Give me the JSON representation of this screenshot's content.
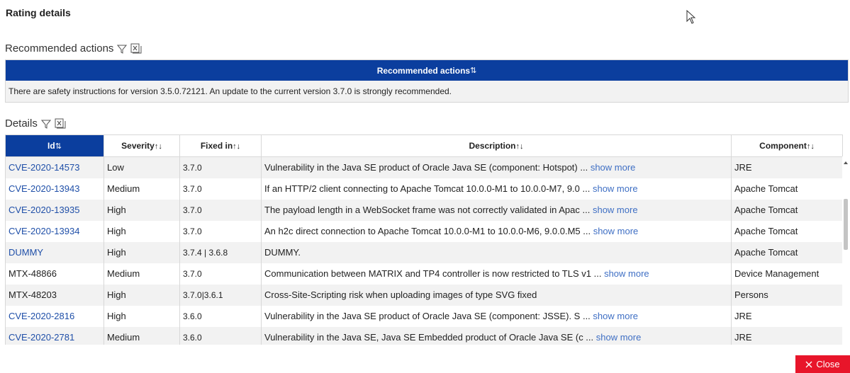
{
  "title": "Rating details",
  "recommended": {
    "section_label": "Recommended actions",
    "header": "Recommended actions",
    "message": "There are safety instructions for version 3.5.0.72121. An update to the current version 3.7.0 is strongly recommended."
  },
  "details": {
    "section_label": "Details",
    "columns": [
      "Id",
      "Severity",
      "Fixed in",
      "Description",
      "Component"
    ],
    "sort_active": "⇅",
    "sort_idle": "↑↓",
    "show_more": "show more",
    "rows": [
      {
        "id": "CVE-2020-14573",
        "link": true,
        "severity": "Low",
        "fixed": "3.7.0",
        "description": "Vulnerability in the Java SE product of Oracle Java SE (component: Hotspot) ...",
        "more": true,
        "component": "JRE"
      },
      {
        "id": "CVE-2020-13943",
        "link": true,
        "severity": "Medium",
        "fixed": "3.7.0",
        "description": "If an HTTP/2 client connecting to Apache Tomcat 10.0.0-M1 to 10.0.0-M7, 9.0 ...",
        "more": true,
        "component": "Apache Tomcat"
      },
      {
        "id": "CVE-2020-13935",
        "link": true,
        "severity": "High",
        "fixed": "3.7.0",
        "description": "The payload length in a WebSocket frame was not correctly validated in Apac ...",
        "more": true,
        "component": "Apache Tomcat"
      },
      {
        "id": "CVE-2020-13934",
        "link": true,
        "severity": "High",
        "fixed": "3.7.0",
        "description": "An h2c direct connection to Apache Tomcat 10.0.0-M1 to 10.0.0-M6, 9.0.0.M5 ...",
        "more": true,
        "component": "Apache Tomcat"
      },
      {
        "id": "DUMMY",
        "link": true,
        "severity": "High",
        "fixed": "3.7.4 | 3.6.8",
        "description": "DUMMY.",
        "more": false,
        "component": "Apache Tomcat"
      },
      {
        "id": "MTX-48866",
        "link": false,
        "severity": "Medium",
        "fixed": "3.7.0",
        "description": "Communication between MATRIX and TP4 controller is now restricted to TLS v1 ...",
        "more": true,
        "component": "Device Management"
      },
      {
        "id": "MTX-48203",
        "link": false,
        "severity": "High",
        "fixed": "3.7.0|3.6.1",
        "description": "Cross-Site-Scripting risk when uploading images of type SVG fixed",
        "more": false,
        "component": "Persons"
      },
      {
        "id": "CVE-2020-2816",
        "link": true,
        "severity": "High",
        "fixed": "3.6.0",
        "description": "Vulnerability in the Java SE product of Oracle Java SE (component: JSSE). S ...",
        "more": true,
        "component": "JRE"
      },
      {
        "id": "CVE-2020-2781",
        "link": true,
        "severity": "Medium",
        "fixed": "3.6.0",
        "description": "Vulnerability in the Java SE, Java SE Embedded product of Oracle Java SE (c ...",
        "more": true,
        "component": "JRE"
      }
    ]
  },
  "close_label": "Close",
  "colors": {
    "header_blue": "#0b3e9e",
    "link": "#1f4fa8",
    "close_red": "#e8152a"
  }
}
